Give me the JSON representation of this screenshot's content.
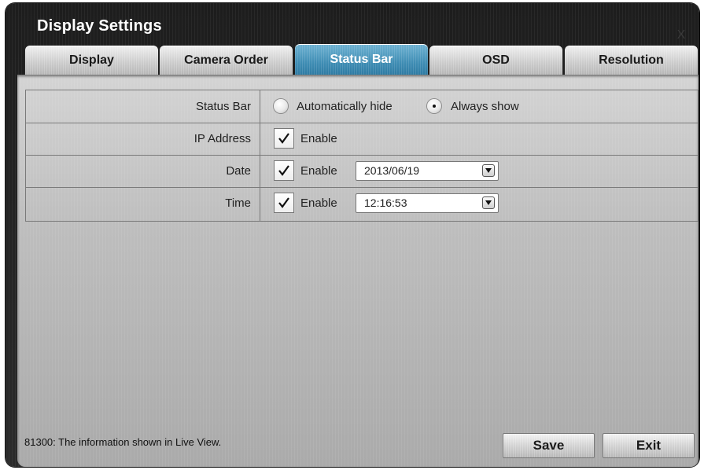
{
  "window": {
    "title": "Display Settings",
    "close_label": "X"
  },
  "tabs": [
    {
      "label": "Display",
      "active": false
    },
    {
      "label": "Camera Order",
      "active": false
    },
    {
      "label": "Status Bar",
      "active": true
    },
    {
      "label": "OSD",
      "active": false
    },
    {
      "label": "Resolution",
      "active": false
    }
  ],
  "status_bar_row": {
    "label": "Status Bar",
    "options": [
      {
        "label": "Automatically hide",
        "selected": false
      },
      {
        "label": "Always show",
        "selected": true
      }
    ]
  },
  "ip_address_row": {
    "label": "IP Address",
    "enable_label": "Enable",
    "checked": true
  },
  "date_row": {
    "label": "Date",
    "enable_label": "Enable",
    "checked": true,
    "value": "2013/06/19"
  },
  "time_row": {
    "label": "Time",
    "enable_label": "Enable",
    "checked": true,
    "value": "12:16:53"
  },
  "footer": {
    "status_text": "81300: The information shown in Live View.",
    "save_label": "Save",
    "exit_label": "Exit"
  },
  "colors": {
    "active_tab": "#3f8db4",
    "window_bg": "#222222",
    "panel_bg": "#c4c4c4"
  }
}
